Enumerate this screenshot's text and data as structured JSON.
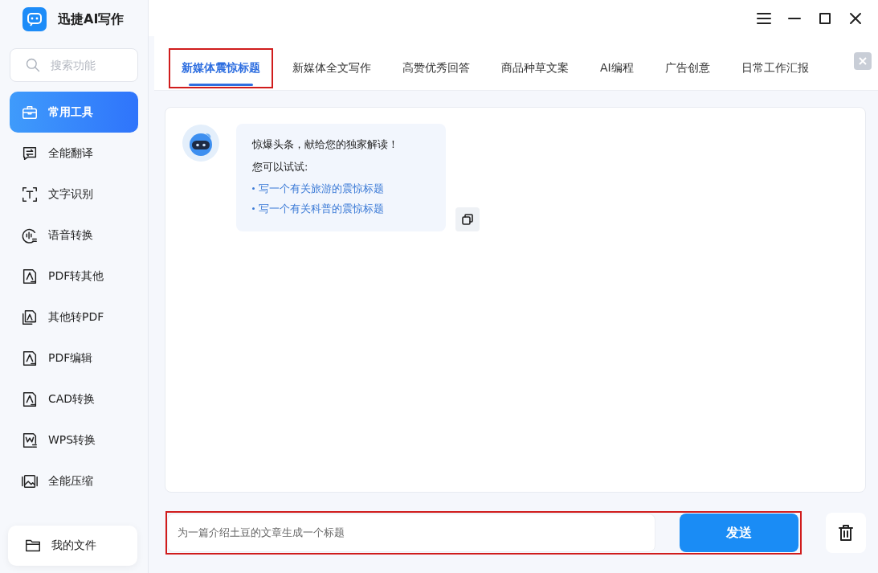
{
  "app": {
    "title": "迅捷AI写作"
  },
  "sidebar": {
    "search": {
      "placeholder": "搜索功能"
    },
    "items": [
      {
        "label": "常用工具",
        "kind": "toolbox",
        "selected": true
      },
      {
        "label": "全能翻译",
        "kind": "translate",
        "selected": false
      },
      {
        "label": "文字识别",
        "kind": "ocr",
        "selected": false
      },
      {
        "label": "语音转换",
        "kind": "voice",
        "selected": false
      },
      {
        "label": "PDF转其他",
        "kind": "doc",
        "selected": false
      },
      {
        "label": "其他转PDF",
        "kind": "docs",
        "selected": false
      },
      {
        "label": "PDF编辑",
        "kind": "doc",
        "selected": false
      },
      {
        "label": "CAD转换",
        "kind": "doc",
        "selected": false
      },
      {
        "label": "WPS转换",
        "kind": "wps",
        "selected": false
      },
      {
        "label": "全能压缩",
        "kind": "image",
        "selected": false
      }
    ],
    "files": {
      "label": "我的文件"
    }
  },
  "tabs": [
    {
      "label": "新媒体震惊标题",
      "selected": true,
      "highlighted": true
    },
    {
      "label": "新媒体全文写作",
      "selected": false,
      "highlighted": false
    },
    {
      "label": "高赞优秀回答",
      "selected": false,
      "highlighted": false
    },
    {
      "label": "商品种草文案",
      "selected": false,
      "highlighted": false
    },
    {
      "label": "AI编程",
      "selected": false,
      "highlighted": false
    },
    {
      "label": "广告创意",
      "selected": false,
      "highlighted": false
    },
    {
      "label": "日常工作汇报",
      "selected": false,
      "highlighted": false
    }
  ],
  "chat": {
    "greeting": "惊爆头条，献给您的独家解读！",
    "prompt": "您可以试试:",
    "suggestions": [
      "写一个有关旅游的震惊标题",
      "写一个有关科普的震惊标题"
    ]
  },
  "composer": {
    "value": "为一篇介绍土豆的文章生成一个标题",
    "send": "发送",
    "highlighted": true
  }
}
